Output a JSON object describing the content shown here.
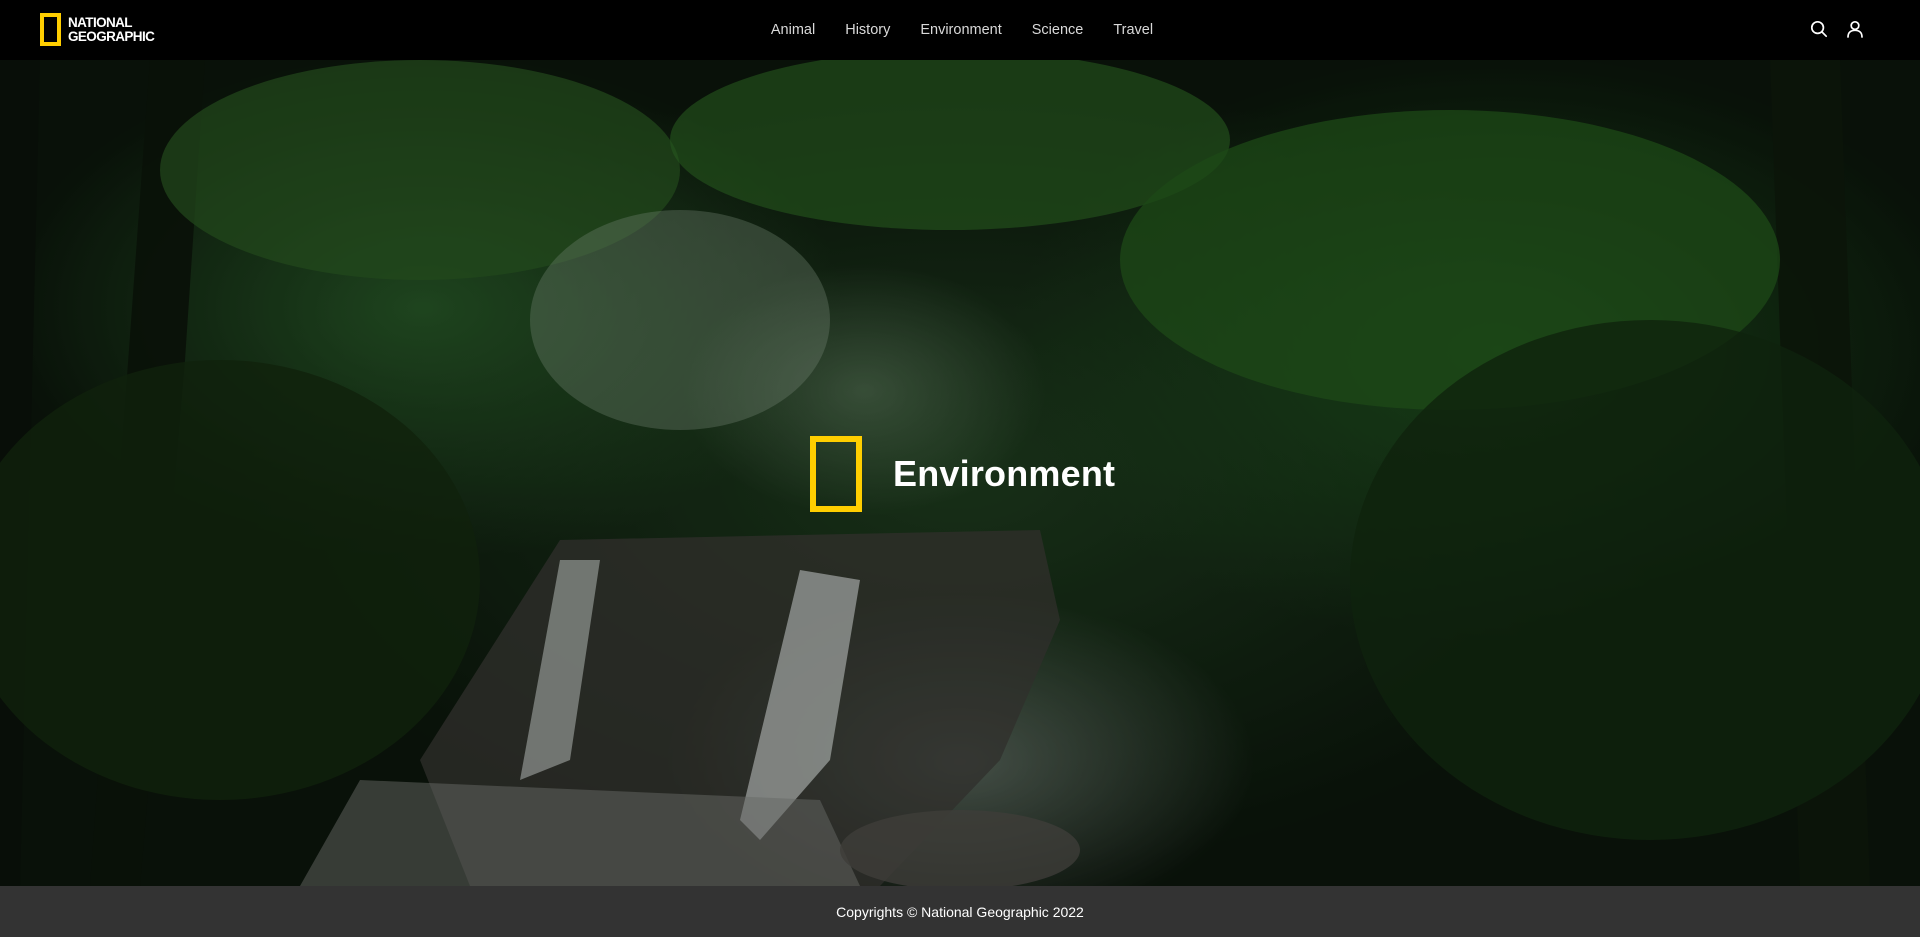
{
  "brand": {
    "logo_line1": "NATIONAL",
    "logo_line2": "GEOGRAPHIC",
    "accent_color": "#FFCE00"
  },
  "nav": {
    "items": [
      {
        "label": "Animal"
      },
      {
        "label": "History"
      },
      {
        "label": "Environment"
      },
      {
        "label": "Science"
      },
      {
        "label": "Travel"
      }
    ]
  },
  "header_icons": {
    "search": "search-icon",
    "account": "user-icon"
  },
  "hero": {
    "title": "Environment",
    "background": "forest-waterfall-image"
  },
  "footer": {
    "text": "Copyrights © National Geographic 2022",
    "background": "#333333"
  }
}
